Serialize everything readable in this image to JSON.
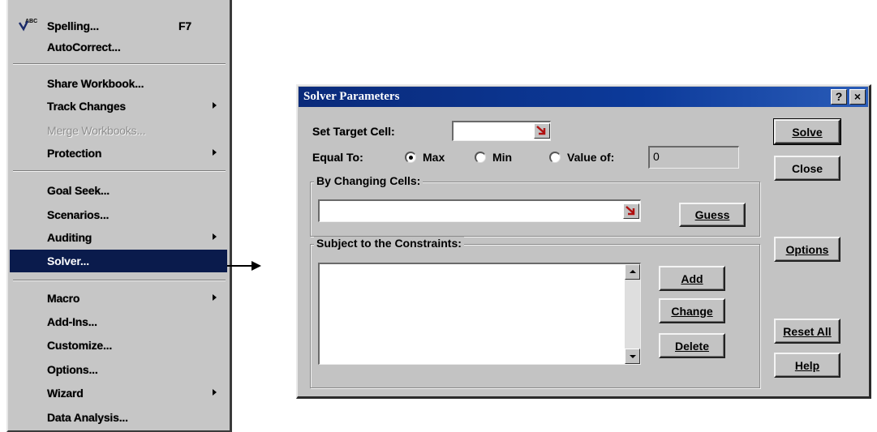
{
  "menu": {
    "items": [
      {
        "label": "Spelling...",
        "shortcut": "F7",
        "submenu": false,
        "state": "normal"
      },
      {
        "label": "AutoCorrect...",
        "submenu": false,
        "state": "normal"
      },
      {
        "label": "Share Workbook...",
        "submenu": false,
        "state": "normal"
      },
      {
        "label": "Track Changes",
        "submenu": true,
        "state": "normal"
      },
      {
        "label": "Merge Workbooks...",
        "submenu": false,
        "state": "disabled"
      },
      {
        "label": "Protection",
        "submenu": true,
        "state": "normal"
      },
      {
        "label": "Goal Seek...",
        "submenu": false,
        "state": "normal"
      },
      {
        "label": "Scenarios...",
        "submenu": false,
        "state": "normal"
      },
      {
        "label": "Auditing",
        "submenu": true,
        "state": "normal"
      },
      {
        "label": "Solver...",
        "submenu": false,
        "state": "highlighted"
      },
      {
        "label": "Macro",
        "submenu": true,
        "state": "normal"
      },
      {
        "label": "Add-Ins...",
        "submenu": false,
        "state": "normal"
      },
      {
        "label": "Customize...",
        "submenu": false,
        "state": "normal"
      },
      {
        "label": "Options...",
        "submenu": false,
        "state": "normal"
      },
      {
        "label": "Wizard",
        "submenu": true,
        "state": "normal"
      },
      {
        "label": "Data Analysis...",
        "submenu": false,
        "state": "normal"
      }
    ],
    "spelling_icon": "spelling-abc-check-icon"
  },
  "dialog": {
    "title": "Solver Parameters",
    "help_button": "?",
    "close_button": "×",
    "set_target_label": "Set Target Cell:",
    "set_target_value": "",
    "equal_to_label": "Equal To:",
    "options": {
      "max": "Max",
      "min": "Min",
      "value_of": "Value of:"
    },
    "selected": "max",
    "value_of_value": "0",
    "by_changing_label": "By Changing Cells:",
    "by_changing_value": "",
    "constraints_label": "Subject to the Constraints:",
    "buttons": {
      "solve": "Solve",
      "close": "Close",
      "guess": "Guess",
      "options": "Options",
      "add": "Add",
      "change": "Change",
      "delete": "Delete",
      "reset_all": "Reset All",
      "help": "Help"
    },
    "ref_icon": "collapse-dialog-icon"
  },
  "colors": {
    "menu_highlight": "#0a1b4c",
    "titlebar": "#0c3a9a",
    "face": "#c3c3c3"
  }
}
